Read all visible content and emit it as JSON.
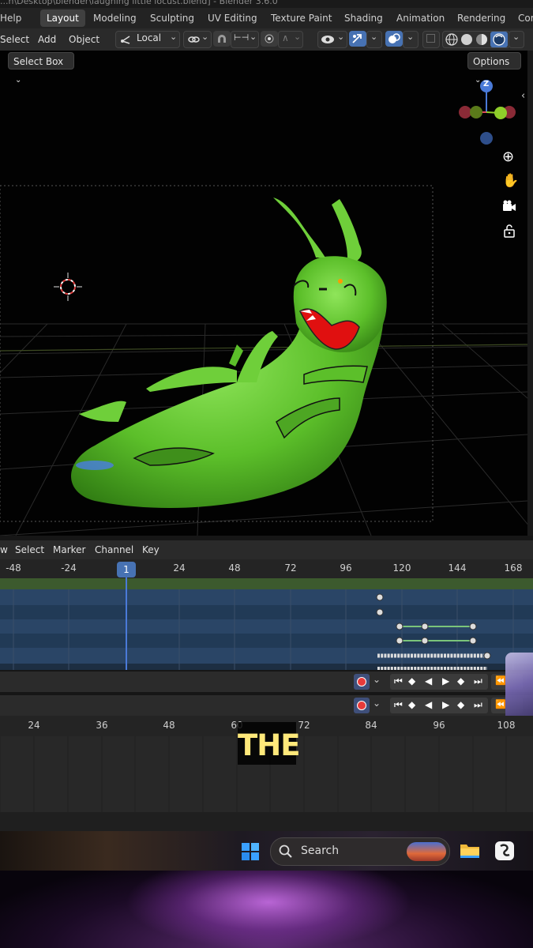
{
  "title_bar": {
    "text": "...n\\Desktop\\blender\\laughing little locust.blend] - Blender 3.6.0"
  },
  "workspace_tabs": [
    {
      "label": "Help"
    },
    {
      "label": "Layout"
    },
    {
      "label": "Modeling"
    },
    {
      "label": "Sculpting"
    },
    {
      "label": "UV Editing"
    },
    {
      "label": "Texture Paint"
    },
    {
      "label": "Shading"
    },
    {
      "label": "Animation"
    },
    {
      "label": "Rendering"
    },
    {
      "label": "Com"
    }
  ],
  "viewport_header": {
    "menus": [
      "Select",
      "Add",
      "Object"
    ],
    "transform_orientation": "Local",
    "select_mode": "Select Box",
    "options_label": "Options"
  },
  "navigation_gizmo": {
    "axis_label": "Z"
  },
  "timeline": {
    "menus": [
      "w",
      "Select",
      "Marker",
      "Channel",
      "Key"
    ],
    "ticks": [
      "-48",
      "-24",
      "24",
      "48",
      "72",
      "96",
      "120",
      "144",
      "168"
    ],
    "current_frame": "1"
  },
  "graph_ruler": {
    "ticks": [
      "24",
      "36",
      "48",
      "60",
      "72",
      "84",
      "96",
      "108"
    ]
  },
  "taskbar": {
    "search_placeholder": "Search"
  },
  "caption": {
    "text": "THE"
  },
  "colors": {
    "accent": "#4772b3",
    "character_green": "#6fcf3a",
    "mouth_red": "#e01010",
    "caption_yellow": "#ffe87a"
  }
}
